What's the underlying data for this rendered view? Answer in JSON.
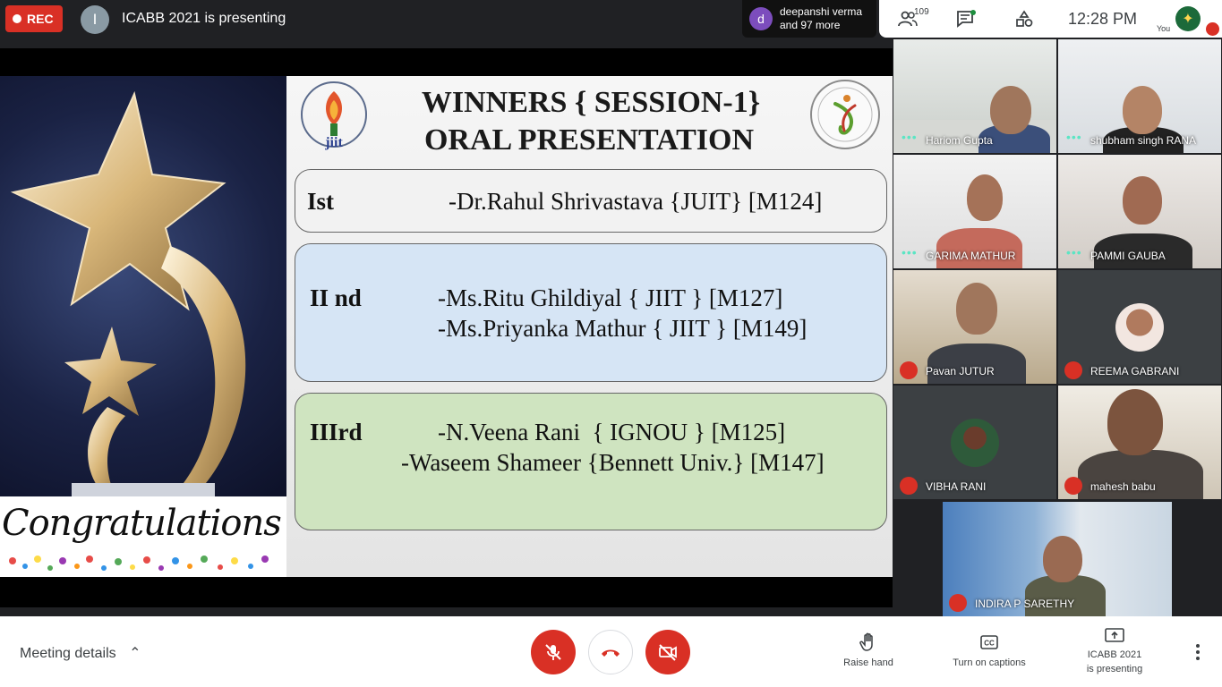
{
  "topbar": {
    "rec_label": "REC",
    "presenter_initial": "I",
    "presenting_title": "ICABB 2021 is presenting",
    "joiner_initial": "d",
    "joiner_line1": "deepanshi verma",
    "joiner_line2": "and 97 more",
    "people_count": "109",
    "clock": "12:28  PM",
    "you_label": "You"
  },
  "slide": {
    "title_line1": "WINNERS { SESSION-1}",
    "title_line2": "ORAL PRESENTATION",
    "jiit_logo_text": "jiit",
    "congrats_text": "Congratulations",
    "places": [
      {
        "rank": "Ist",
        "winners": [
          "-Dr.Rahul Shrivastava {JUIT} [M124]"
        ],
        "color": "#f2f2f2"
      },
      {
        "rank": "II nd",
        "winners": [
          "-Ms.Ritu Ghildiyal { JIIT } [M127]",
          "-Ms.Priyanka Mathur { JIIT } [M149]"
        ],
        "color": "#d6e5f5"
      },
      {
        "rank": "IIIrd",
        "winners": [
          "-N.Veena Rani  { IGNOU } [M125]",
          "-Waseem Shameer {Bennett Univ.} [M147]"
        ],
        "color": "#cfe4c0"
      }
    ]
  },
  "participants": [
    {
      "name": "Hariom Gupta",
      "state": "speaking"
    },
    {
      "name": "shubham singh RANA",
      "state": "speaking"
    },
    {
      "name": "GARIMA MATHUR",
      "state": "speaking"
    },
    {
      "name": "PAMMI GAUBA",
      "state": "speaking"
    },
    {
      "name": "Pavan JUTUR",
      "state": "muted"
    },
    {
      "name": "REEMA GABRANI",
      "state": "muted"
    },
    {
      "name": "VIBHA RANI",
      "state": "muted"
    },
    {
      "name": "mahesh babu",
      "state": "muted"
    },
    {
      "name": "INDIRA P SARETHY",
      "state": "muted"
    }
  ],
  "bottombar": {
    "meeting_details": "Meeting details",
    "raise_hand": "Raise hand",
    "captions": "Turn on captions",
    "presenting_line1": "ICABB 2021",
    "presenting_line2": "is presenting"
  },
  "colors": {
    "rec_red": "#d93025",
    "mute_red": "#d93025",
    "speaking_teal": "#5be5c4"
  }
}
